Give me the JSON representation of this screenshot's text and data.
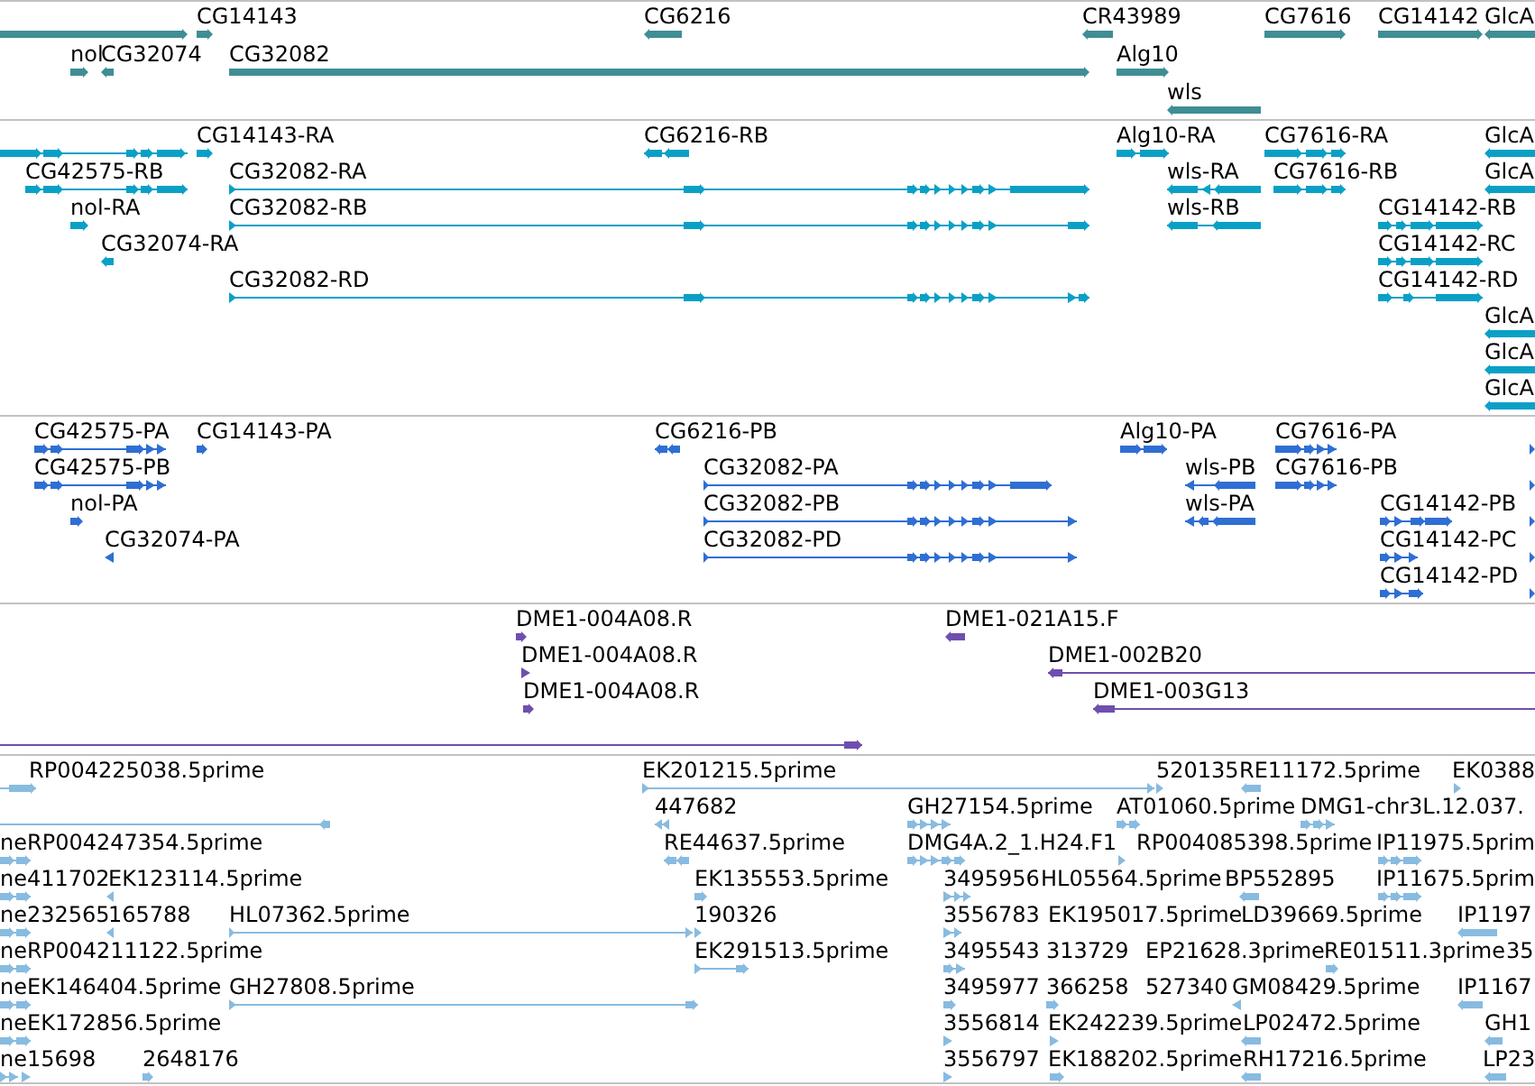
{
  "tracks": [
    {
      "color": "#3f8e94",
      "rows": [
        {
          "features": [
            {
              "reverse": false
            },
            {
              "label": "CG14143",
              "reverse": false
            },
            {
              "label": "CG6216",
              "reverse": true
            },
            {
              "label": "CR43989",
              "reverse": true
            },
            {
              "label": "CG7616",
              "reverse": false
            },
            {
              "label": "CG14142",
              "reverse": false
            },
            {
              "label": "GlcA",
              "reverse": true
            }
          ]
        },
        {
          "features": [
            {
              "label": "nol",
              "reverse": false
            },
            {
              "label": "CG32074",
              "reverse": true
            },
            {
              "label": "CG32082",
              "reverse": false
            },
            {
              "label": "Alg10",
              "reverse": false
            }
          ]
        },
        {
          "features": [
            {
              "label": "wls",
              "reverse": true
            }
          ]
        }
      ]
    },
    {
      "color": "#0aa0c6",
      "rows": [
        {
          "features": [
            {
              "reverse": false
            },
            {
              "label": "CG14143-RA",
              "reverse": false
            },
            {
              "label": "CG6216-RB",
              "reverse": true
            },
            {
              "label": "Alg10-RA",
              "reverse": false
            },
            {
              "label": "CG7616-RA",
              "reverse": false
            },
            {
              "label": "GlcA",
              "reverse": true
            }
          ]
        },
        {
          "features": [
            {
              "label": "CG42575-RB",
              "reverse": false
            },
            {
              "label": "CG32082-RA",
              "reverse": false
            },
            {
              "label": "wls-RA",
              "reverse": true
            },
            {
              "label": "CG7616-RB",
              "reverse": false
            },
            {
              "label": "GlcA",
              "reverse": true
            }
          ]
        },
        {
          "features": [
            {
              "label": "nol-RA",
              "reverse": false
            },
            {
              "label": "CG32082-RB",
              "reverse": false
            },
            {
              "label": "wls-RB",
              "reverse": true
            },
            {
              "label": "CG14142-RB",
              "reverse": false
            }
          ]
        },
        {
          "features": [
            {
              "label": "CG32074-RA",
              "reverse": true
            },
            {
              "label": "CG14142-RC",
              "reverse": false
            }
          ]
        },
        {
          "features": [
            {
              "label": "CG32082-RD",
              "reverse": false
            },
            {
              "label": "CG14142-RD",
              "reverse": false
            }
          ]
        },
        {
          "features": [
            {
              "label": "GlcA",
              "reverse": true
            }
          ]
        },
        {
          "features": [
            {
              "label": "GlcA",
              "reverse": true
            }
          ]
        },
        {
          "features": [
            {
              "label": "GlcA",
              "reverse": true
            }
          ]
        }
      ]
    },
    {
      "color": "#2f6ed3",
      "rows": [
        {
          "features": [
            {
              "label": "CG42575-PA",
              "reverse": false
            },
            {
              "label": "CG14143-PA",
              "reverse": false
            },
            {
              "label": "CG6216-PB",
              "reverse": true
            },
            {
              "label": "Alg10-PA",
              "reverse": false
            },
            {
              "label": "CG7616-PA",
              "reverse": false
            },
            {
              "reverse": false
            }
          ]
        },
        {
          "features": [
            {
              "label": "CG42575-PB",
              "reverse": false
            },
            {
              "label": "CG32082-PA",
              "reverse": false
            },
            {
              "label": "wls-PB",
              "reverse": true
            },
            {
              "label": "CG7616-PB",
              "reverse": false
            },
            {
              "reverse": false
            }
          ]
        },
        {
          "features": [
            {
              "label": "nol-PA",
              "reverse": false
            },
            {
              "label": "CG32082-PB",
              "reverse": false
            },
            {
              "label": "wls-PA",
              "reverse": true
            },
            {
              "label": "CG14142-PB",
              "reverse": false
            },
            {
              "reverse": false
            }
          ]
        },
        {
          "features": [
            {
              "label": "CG32074-PA",
              "reverse": true
            },
            {
              "label": "CG32082-PD",
              "reverse": false
            },
            {
              "label": "CG14142-PC",
              "reverse": false
            },
            {
              "reverse": false
            }
          ]
        },
        {
          "features": [
            {
              "label": "CG14142-PD",
              "reverse": false
            },
            {
              "reverse": false
            }
          ]
        }
      ]
    },
    {
      "color": "#6e4fae",
      "rows": [
        {
          "features": [
            {
              "label": "DME1-004A08.R",
              "reverse": false
            },
            {
              "label": "DME1-021A15.F",
              "reverse": true
            }
          ]
        },
        {
          "features": [
            {
              "label": "DME1-004A08.R",
              "reverse": false
            },
            {
              "label": "DME1-002B20",
              "reverse": true
            }
          ]
        },
        {
          "features": [
            {
              "label": "DME1-004A08.R",
              "reverse": false
            },
            {
              "label": "DME1-003G13",
              "reverse": true
            }
          ]
        },
        {
          "features": [
            {
              "reverse": false
            }
          ]
        }
      ]
    },
    {
      "color": "#88bbe0",
      "rows": [
        {
          "features": [
            {
              "label": "RP004225038.5prime",
              "reverse": false
            },
            {
              "label": "EK201215.5prime",
              "reverse": false
            },
            {
              "label": "520135",
              "reverse": false
            },
            {
              "label": "RE11172.5prime",
              "reverse": true
            },
            {
              "label": "EK0388",
              "reverse": false
            }
          ]
        },
        {
          "features": [
            {
              "reverse": true
            },
            {
              "label": "447682",
              "reverse": true
            },
            {
              "label": "GH27154.5prime",
              "reverse": false
            },
            {
              "label": "AT01060.5prime",
              "reverse": false
            },
            {
              "label": "DMG1-chr3L.12.037.",
              "reverse": false
            }
          ]
        },
        {
          "features": [
            {
              "label": "ne",
              "reverse": false
            },
            {
              "label": "RP004247354.5prime"
            },
            {
              "label": "RE44637.5prime",
              "reverse": true
            },
            {
              "label": "DMG4A.2_1.H24.F1",
              "reverse": false
            },
            {
              "label": "RP004085398.5prime",
              "reverse": false
            },
            {
              "label": "IP11975.5prim",
              "reverse": false
            }
          ]
        },
        {
          "features": [
            {
              "label": "ne",
              "reverse": false
            },
            {
              "label": "411702"
            },
            {
              "label": "EK123114.5prime",
              "reverse": true
            },
            {
              "label": "EK135553.5prime",
              "reverse": false
            },
            {
              "label": "3495956",
              "reverse": false
            },
            {
              "label": "HL05564.5prime"
            },
            {
              "label": "BP552895",
              "reverse": true
            },
            {
              "label": "IP11675.5prim",
              "reverse": false
            }
          ]
        },
        {
          "features": [
            {
              "label": "ne",
              "reverse": false
            },
            {
              "label": "232565"
            },
            {
              "label": "165788",
              "reverse": true
            },
            {
              "label": "HL07362.5prime",
              "reverse": false
            },
            {
              "label": "190326",
              "reverse": false
            },
            {
              "label": "3556783",
              "reverse": false
            },
            {
              "label": "EK195017.5prime"
            },
            {
              "label": "LD39669.5prime"
            },
            {
              "label": "IP1197",
              "reverse": true
            }
          ]
        },
        {
          "features": [
            {
              "label": "ne",
              "reverse": false
            },
            {
              "label": "RP004211122.5prime"
            },
            {
              "label": "EK291513.5prime",
              "reverse": false
            },
            {
              "label": "3495543",
              "reverse": false
            },
            {
              "label": "313729"
            },
            {
              "label": "EP21628.3prime"
            },
            {
              "label": "RE01511.3prime",
              "reverse": false
            },
            {
              "label": "35"
            }
          ]
        },
        {
          "features": [
            {
              "label": "ne",
              "reverse": false
            },
            {
              "label": "EK146404.5prime"
            },
            {
              "label": "GH27808.5prime",
              "reverse": false
            },
            {
              "label": "3495977",
              "reverse": false
            },
            {
              "label": "366258",
              "reverse": false
            },
            {
              "label": "527340"
            },
            {
              "label": "GM08429.5prime",
              "reverse": true
            },
            {
              "label": "IP1167",
              "reverse": true
            }
          ]
        },
        {
          "features": [
            {
              "label": "ne",
              "reverse": false
            },
            {
              "label": "EK172856.5prime"
            },
            {
              "label": "3556814",
              "reverse": false
            },
            {
              "label": "EK242239.5prime",
              "reverse": false
            },
            {
              "label": "LP02472.5prime",
              "reverse": true
            },
            {
              "label": "GH1",
              "reverse": true
            }
          ]
        },
        {
          "features": [
            {
              "label": "ne",
              "reverse": false
            },
            {
              "label": "15698",
              "reverse": false
            },
            {
              "label": "2648176",
              "reverse": false
            },
            {
              "label": "3556797",
              "reverse": false
            },
            {
              "label": "EK188202.5prime",
              "reverse": false
            },
            {
              "label": "RH17216.5prime",
              "reverse": true
            },
            {
              "label": "LP23",
              "reverse": true
            }
          ]
        }
      ]
    }
  ]
}
